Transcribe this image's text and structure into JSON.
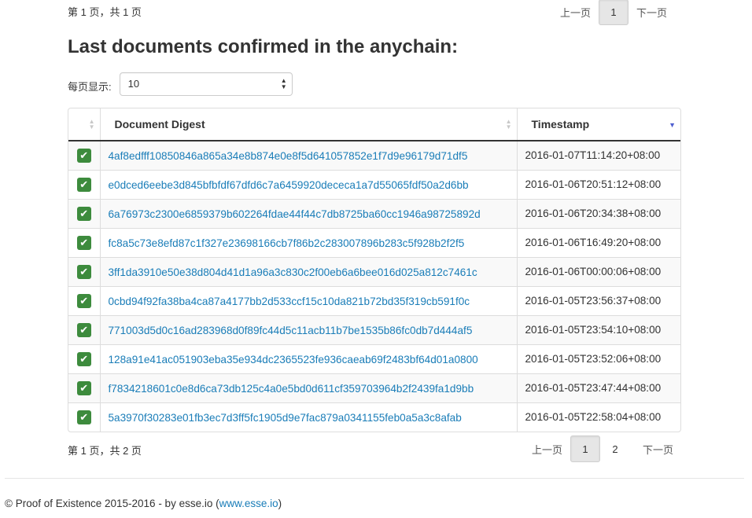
{
  "top_pager": {
    "info": "第 1 页，共 1 页",
    "prev": "上一页",
    "pages": [
      "1"
    ],
    "next": "下一页"
  },
  "title": "Last documents confirmed in the anychain:",
  "per_page": {
    "label": "每页显示:",
    "value": "10"
  },
  "table": {
    "columns": [
      "",
      "Document Digest",
      "Timestamp"
    ],
    "sorted_column": "Timestamp",
    "sort_direction": "descending",
    "rows": [
      {
        "digest": "4af8edfff10850846a865a34e8b874e0e8f5d641057852e1f7d9e96179d71df5",
        "timestamp": "2016-01-07T11:14:20+08:00"
      },
      {
        "digest": "e0dced6eebe3d845bfbfdf67dfd6c7a6459920dececa1a7d55065fdf50a2d6bb",
        "timestamp": "2016-01-06T20:51:12+08:00"
      },
      {
        "digest": "6a76973c2300e6859379b602264fdae44f44c7db8725ba60cc1946a98725892d",
        "timestamp": "2016-01-06T20:34:38+08:00"
      },
      {
        "digest": "fc8a5c73e8efd87c1f327e23698166cb7f86b2c283007896b283c5f928b2f2f5",
        "timestamp": "2016-01-06T16:49:20+08:00"
      },
      {
        "digest": "3ff1da3910e50e38d804d41d1a96a3c830c2f00eb6a6bee016d025a812c7461c",
        "timestamp": "2016-01-06T00:00:06+08:00"
      },
      {
        "digest": "0cbd94f92fa38ba4ca87a4177bb2d533ccf15c10da821b72bd35f319cb591f0c",
        "timestamp": "2016-01-05T23:56:37+08:00"
      },
      {
        "digest": "771003d5d0c16ad283968d0f89fc44d5c11acb11b7be1535b86fc0db7d444af5",
        "timestamp": "2016-01-05T23:54:10+08:00"
      },
      {
        "digest": "128a91e41ac051903eba35e934dc2365523fe936caeab69f2483bf64d01a0800",
        "timestamp": "2016-01-05T23:52:06+08:00"
      },
      {
        "digest": "f7834218601c0e8d6ca73db125c4a0e5bd0d611cf359703964b2f2439fa1d9bb",
        "timestamp": "2016-01-05T23:47:44+08:00"
      },
      {
        "digest": "5a3970f30283e01fb3ec7d3ff5fc1905d9e7fac879a0341155feb0a5a3c8afab",
        "timestamp": "2016-01-05T22:58:04+08:00"
      }
    ]
  },
  "bottom_pager": {
    "info": "第 1 页，共 2 页",
    "prev": "上一页",
    "pages": [
      "1",
      "2"
    ],
    "next": "下一页"
  },
  "footer": {
    "text_prefix": "© Proof of Existence 2015-2016 - by esse.io (",
    "link": "www.esse.io",
    "text_suffix": ")"
  },
  "colors": {
    "link": "#1a7db8",
    "check": "#3d8b3d",
    "sort_active": "#4f5fd0"
  }
}
